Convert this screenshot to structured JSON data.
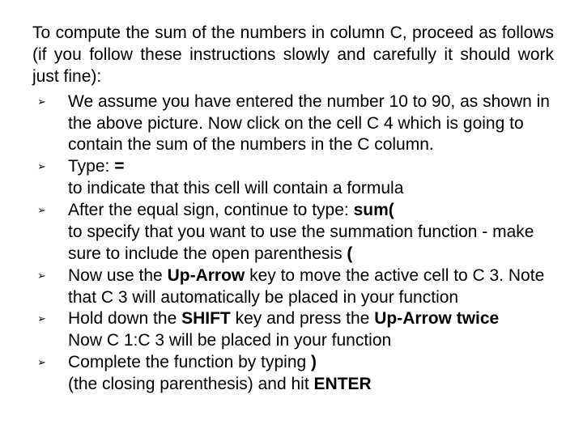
{
  "intro": "To compute the sum of the numbers in column C, proceed as follows (if you follow these instructions slowly and carefully it should work just fine):",
  "items": {
    "i0": {
      "a": "We assume you have entered the number 10 to 90, as shown in the above picture. Now click on the cell C 4 which is going to contain the sum of the numbers in the C column."
    },
    "i1": {
      "a": "Type:   ",
      "b": "=",
      "c": "to indicate that this cell will contain a formula"
    },
    "i2": {
      "a": "After the equal sign, continue to type: ",
      "b": "sum(",
      "c": "to specify that you want to use the summation function - make sure to include the open parenthesis ",
      "d": "("
    },
    "i3": {
      "a": "Now use the ",
      "b": "Up-Arrow",
      "c": " key to move the active cell to C 3. Note that C 3 will automatically be placed in your function"
    },
    "i4": {
      "a": "Hold down the ",
      "b": "SHIFT",
      "c": " key and press the ",
      "d": "Up-Arrow twice",
      "e": "Now C 1:C 3 will be placed in your function"
    },
    "i5": {
      "a": "Complete the function by typing   ",
      "b": ")",
      "c": "(the closing parenthesis) and hit ",
      "d": "ENTER"
    }
  }
}
